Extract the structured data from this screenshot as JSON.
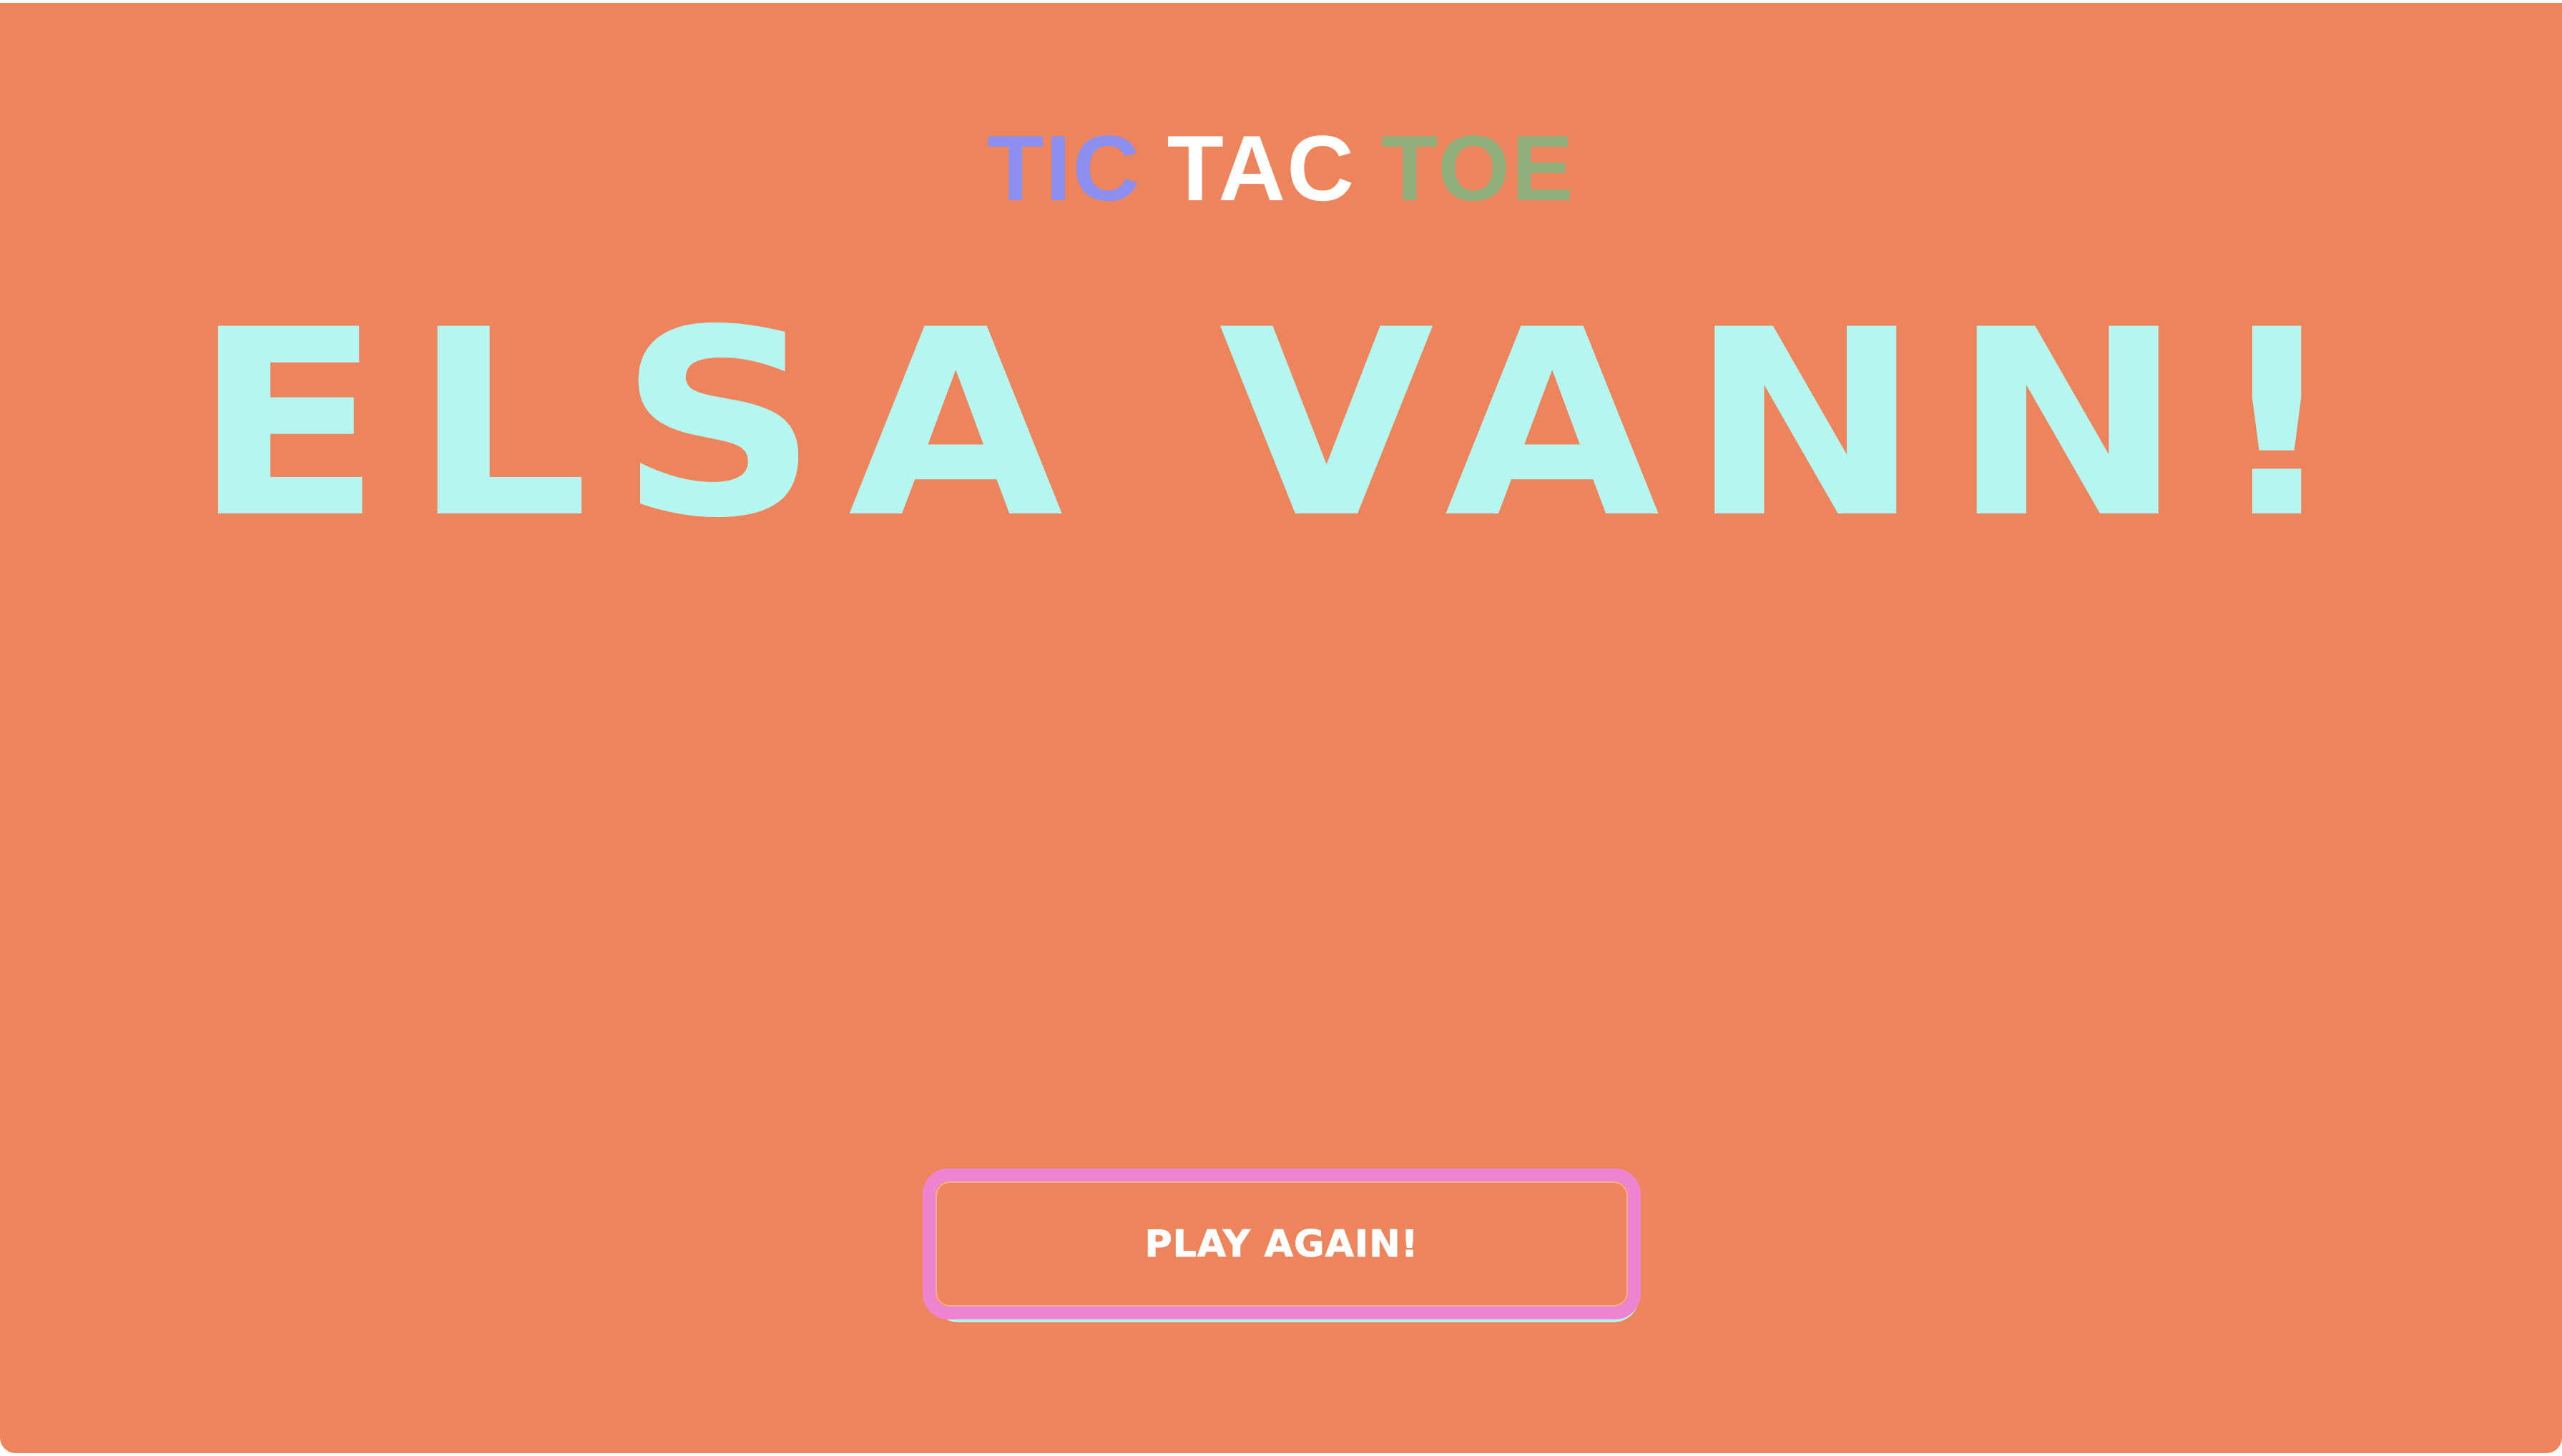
{
  "game": {
    "title_parts": [
      "TIC",
      "TAC",
      "TOE"
    ],
    "result_text": "ELSA VANN!",
    "play_again_label": "PLAY AGAIN!"
  },
  "colors": {
    "background": "#ee845b",
    "title_tic": "#8b8ff0",
    "title_tac": "#ffffff",
    "title_toe": "#8fb07d",
    "result_text": "#b5f7f0",
    "button_border": "#ee84d0",
    "button_shadow": "#b5f7f0",
    "button_text": "#ffffff"
  }
}
